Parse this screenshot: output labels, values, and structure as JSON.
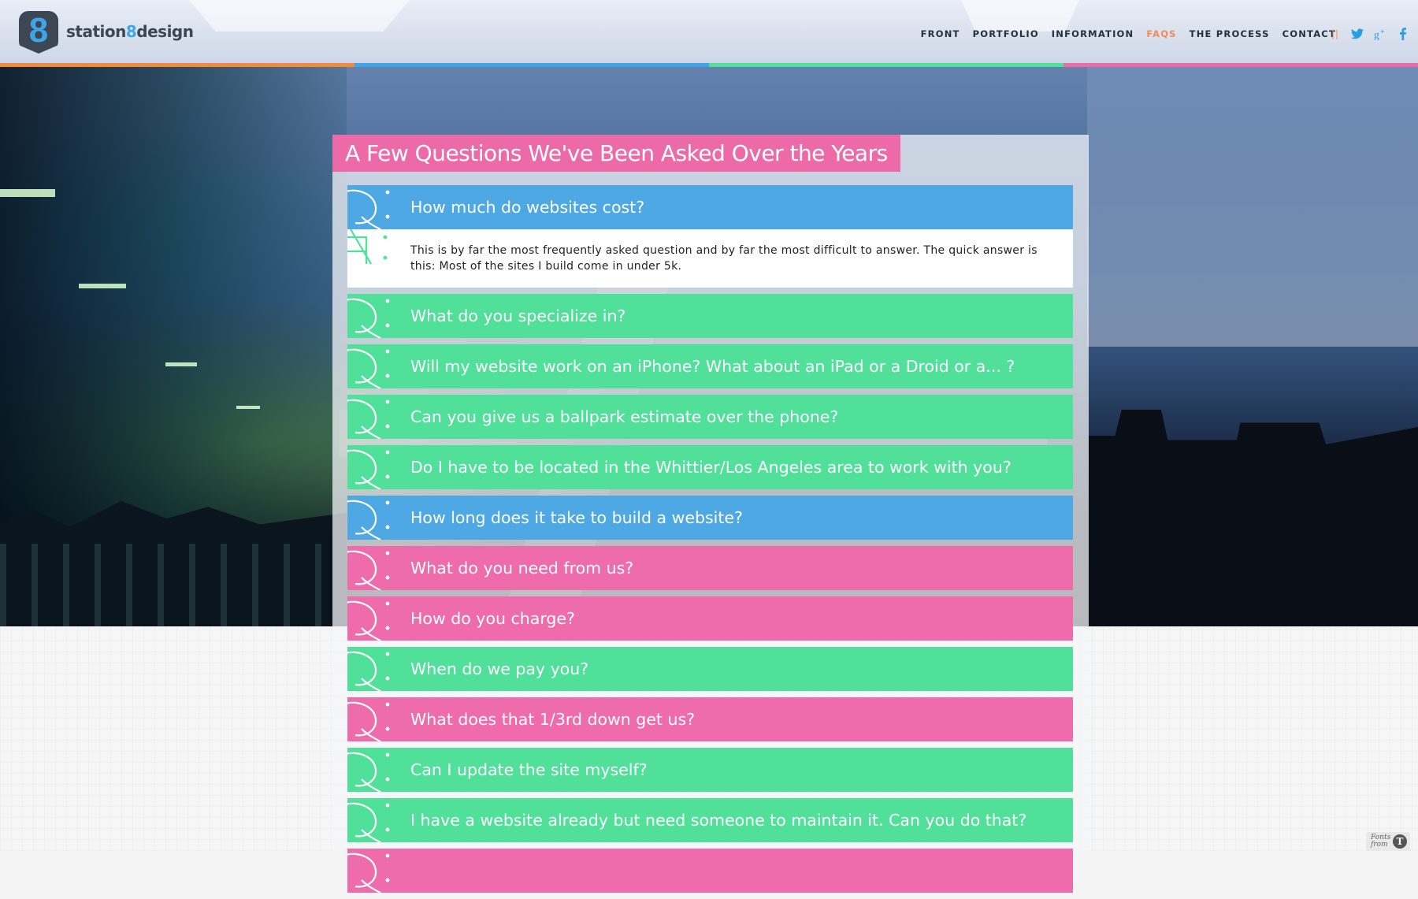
{
  "header": {
    "logo_badge": "8",
    "logo_text_a": "station",
    "logo_text_b": "8",
    "logo_text_c": "design",
    "nav": [
      {
        "label": "FRONT",
        "active": false
      },
      {
        "label": "PORTFOLIO",
        "active": false
      },
      {
        "label": "INFORMATION",
        "active": false
      },
      {
        "label": "FAQS",
        "active": true
      },
      {
        "label": "THE PROCESS",
        "active": false
      },
      {
        "label": "CONTACT",
        "active": false
      }
    ],
    "separator": "||",
    "social_icons": [
      "twitter-icon",
      "google-plus-icon",
      "facebook-icon"
    ]
  },
  "colors": {
    "orange": "#f28a3a",
    "blue": "#3ea6e6",
    "green": "#4fe09a",
    "pink": "#ec6aa8",
    "faq_blue": "#4da8e4",
    "faq_green": "#50e09a",
    "faq_pink": "#ee6cac"
  },
  "page": {
    "title": "A Few Questions We've Been Asked Over the Years"
  },
  "faqs": [
    {
      "question": "How much do websites cost?",
      "color": "blue",
      "expanded": true,
      "answer": "This is by far the most frequently asked question and by far the most difficult to answer. The quick answer is this: Most of the sites I build come in under 5k."
    },
    {
      "question": "What do you specialize in?",
      "color": "green"
    },
    {
      "question": "Will my website work on an iPhone? What about an iPad or a Droid or a... ?",
      "color": "green"
    },
    {
      "question": "Can you give us a ballpark estimate over the phone?",
      "color": "green"
    },
    {
      "question": "Do I have to be located in the Whittier/Los Angeles area to work with you?",
      "color": "green"
    },
    {
      "question": "How long does it take to build a website?",
      "color": "blue"
    },
    {
      "question": "What do you need from us?",
      "color": "pink"
    },
    {
      "question": "How do you charge?",
      "color": "pink"
    },
    {
      "question": "When do we pay you?",
      "color": "green"
    },
    {
      "question": "What does that 1/3rd down get us?",
      "color": "pink"
    },
    {
      "question": "Can I update the site myself?",
      "color": "green"
    },
    {
      "question": "I have a website already but need someone to maintain it. Can you do that?",
      "color": "green"
    },
    {
      "question": "",
      "color": "pink"
    }
  ],
  "fonts_badge": {
    "line1": "Fonts",
    "line2": "from"
  }
}
